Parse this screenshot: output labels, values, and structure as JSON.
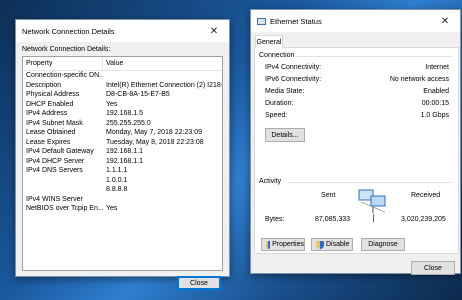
{
  "ncd": {
    "title": "Network Connection Details",
    "label": "Network Connection Details:",
    "col_property": "Property",
    "col_value": "Value",
    "rows": [
      {
        "p": "Connection-specific DN...",
        "v": ""
      },
      {
        "p": "Description",
        "v": "Intel(R) Ethernet Connection (2) I218-V"
      },
      {
        "p": "Physical Address",
        "v": "D8-CB-8A-15-E7-B5"
      },
      {
        "p": "DHCP Enabled",
        "v": "Yes"
      },
      {
        "p": "IPv4 Address",
        "v": "192.168.1.5"
      },
      {
        "p": "IPv4 Subnet Mask",
        "v": "255.255.255.0"
      },
      {
        "p": "Lease Obtained",
        "v": "Monday, May 7, 2018 22:23:09"
      },
      {
        "p": "Lease Expires",
        "v": "Tuesday, May 8, 2018 22:23:08"
      },
      {
        "p": "IPv4 Default Gateway",
        "v": "192.168.1.1"
      },
      {
        "p": "IPv4 DHCP Server",
        "v": "192.168.1.1"
      },
      {
        "p": "IPv4 DNS Servers",
        "v": "1.1.1.1"
      },
      {
        "p": "",
        "v": "1.0.0.1"
      },
      {
        "p": "",
        "v": "8.8.8.8"
      },
      {
        "p": "IPv4 WINS Server",
        "v": ""
      },
      {
        "p": "NetBIOS over Tcpip En...",
        "v": "Yes"
      }
    ],
    "close_label": "Close"
  },
  "eth": {
    "title": "Ethernet Status",
    "tab_general": "General",
    "connection_title": "Connection",
    "connection": {
      "ipv4_label": "IPv4 Connectivity:",
      "ipv4_value": "Internet",
      "ipv6_label": "IPv6 Connectivity:",
      "ipv6_value": "No network access",
      "media_label": "Media State:",
      "media_value": "Enabled",
      "duration_label": "Duration:",
      "duration_value": "00:00:15",
      "speed_label": "Speed:",
      "speed_value": "1.0 Gbps"
    },
    "details_label": "Details...",
    "activity_title": "Activity",
    "sent_label": "Sent",
    "received_label": "Received",
    "bytes_label": "Bytes:",
    "bytes_sent": "87,085,333",
    "bytes_received": "3,020,239,205",
    "properties_label": "Properties",
    "disable_label": "Disable",
    "diagnose_label": "Diagnose",
    "close_label": "Close"
  },
  "colors": {
    "accent": "#0078d7",
    "desktop": "#1b5aa0"
  }
}
